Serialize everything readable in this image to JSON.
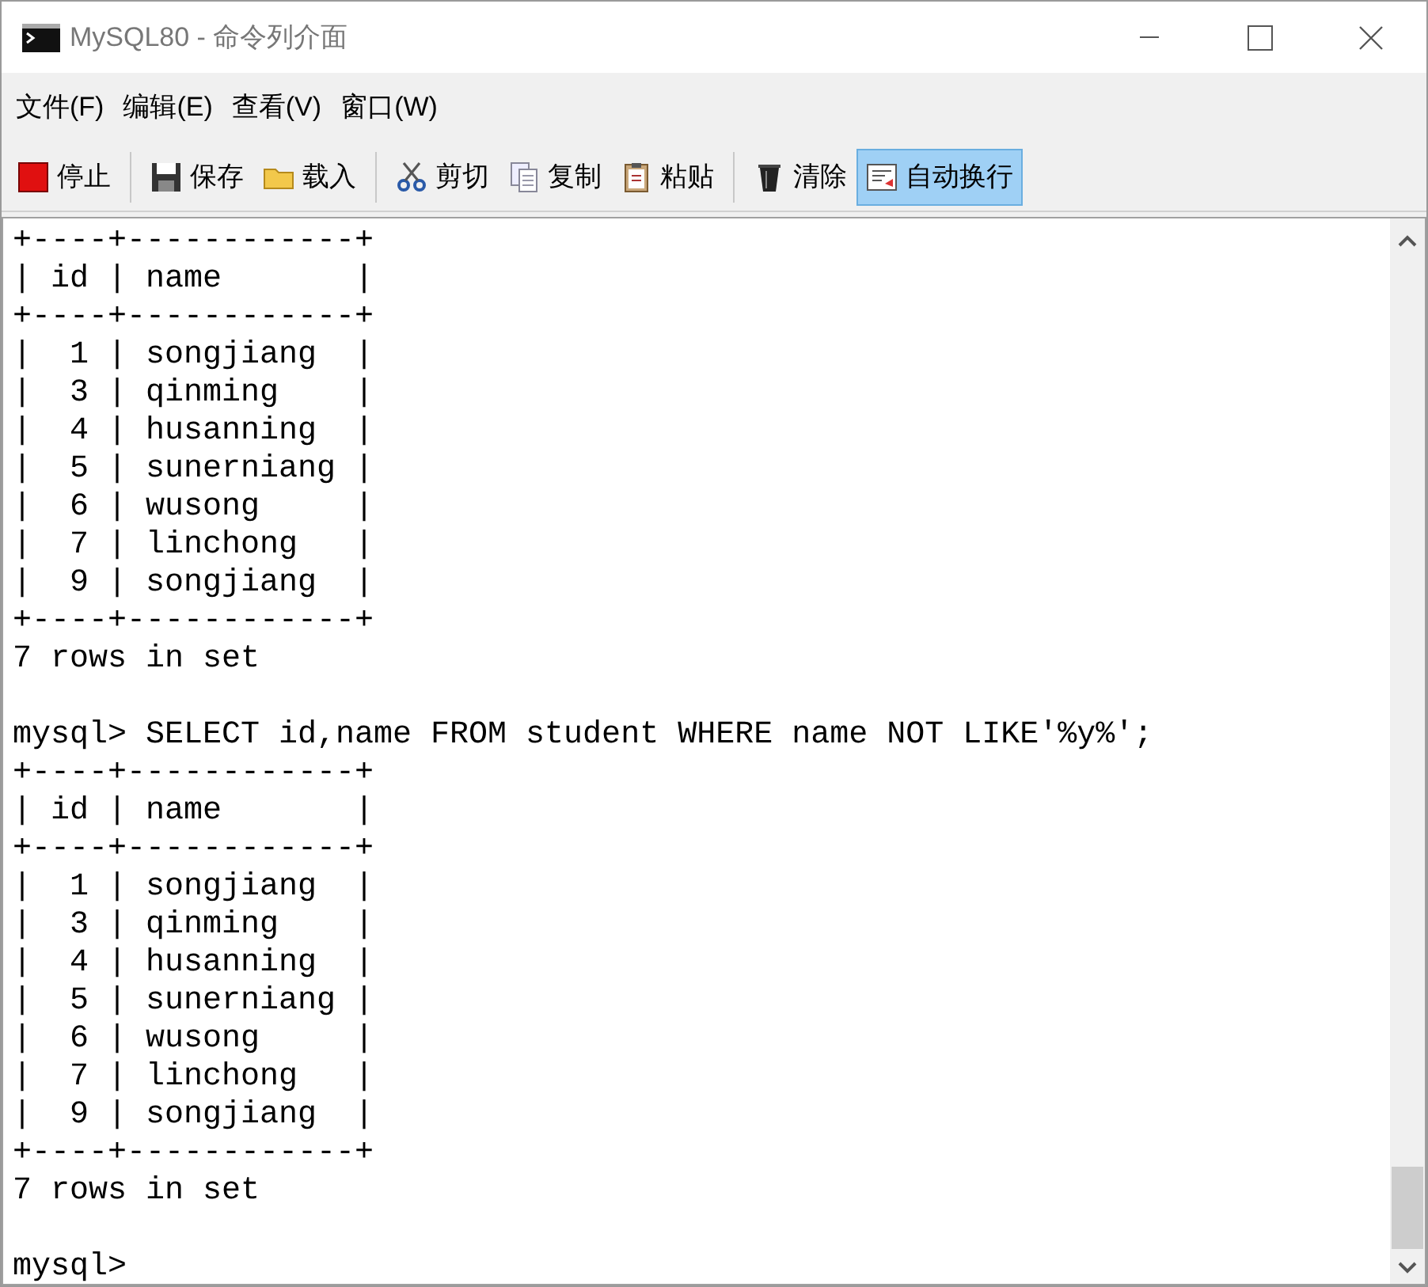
{
  "window": {
    "title": "MySQL80 - 命令列介面"
  },
  "menu": [
    "文件(F)",
    "编辑(E)",
    "查看(V)",
    "窗口(W)"
  ],
  "toolbar": [
    [
      {
        "kind": "stop",
        "label": "停止",
        "pressed": false
      }
    ],
    [
      {
        "kind": "save",
        "label": "保存",
        "pressed": false
      },
      {
        "kind": "load",
        "label": "载入",
        "pressed": false
      }
    ],
    [
      {
        "kind": "cut",
        "label": "剪切",
        "pressed": false
      },
      {
        "kind": "copy",
        "label": "复制",
        "pressed": false
      },
      {
        "kind": "paste",
        "label": "粘贴",
        "pressed": false
      }
    ],
    [
      {
        "kind": "clear",
        "label": "清除",
        "pressed": false
      },
      {
        "kind": "wrap",
        "label": "自动换行",
        "pressed": true
      }
    ]
  ],
  "console": {
    "lines": [
      {
        "kind": "text",
        "text": "+----+------------+"
      },
      {
        "kind": "text",
        "text": "| id | name       |"
      },
      {
        "kind": "text",
        "text": "+----+------------+"
      },
      {
        "kind": "text",
        "text": "|  1 | songjiang  |"
      },
      {
        "kind": "text",
        "text": "|  3 | qinming    |"
      },
      {
        "kind": "text",
        "text": "|  4 | husanning  |"
      },
      {
        "kind": "text",
        "text": "|  5 | sunerniang |"
      },
      {
        "kind": "text",
        "text": "|  6 | wusong     |"
      },
      {
        "kind": "text",
        "text": "|  7 | linchong   |"
      },
      {
        "kind": "text",
        "text": "|  9 | songjiang  |"
      },
      {
        "kind": "text",
        "text": "+----+------------+"
      },
      {
        "kind": "text",
        "text": "7 rows in set"
      },
      {
        "kind": "blank"
      },
      {
        "kind": "text",
        "text": "mysql> SELECT id,name FROM student WHERE name NOT LIKE'%y%';"
      },
      {
        "kind": "text",
        "text": "+----+------------+"
      },
      {
        "kind": "text",
        "text": "| id | name       |"
      },
      {
        "kind": "text",
        "text": "+----+------------+"
      },
      {
        "kind": "text",
        "text": "|  1 | songjiang  |"
      },
      {
        "kind": "text",
        "text": "|  3 | qinming    |"
      },
      {
        "kind": "text",
        "text": "|  4 | husanning  |"
      },
      {
        "kind": "text",
        "text": "|  5 | sunerniang |"
      },
      {
        "kind": "text",
        "text": "|  6 | wusong     |"
      },
      {
        "kind": "text",
        "text": "|  7 | linchong   |"
      },
      {
        "kind": "text",
        "text": "|  9 | songjiang  |"
      },
      {
        "kind": "text",
        "text": "+----+------------+"
      },
      {
        "kind": "text",
        "text": "7 rows in set"
      },
      {
        "kind": "blank"
      },
      {
        "kind": "text",
        "text": "mysql>"
      }
    ]
  }
}
